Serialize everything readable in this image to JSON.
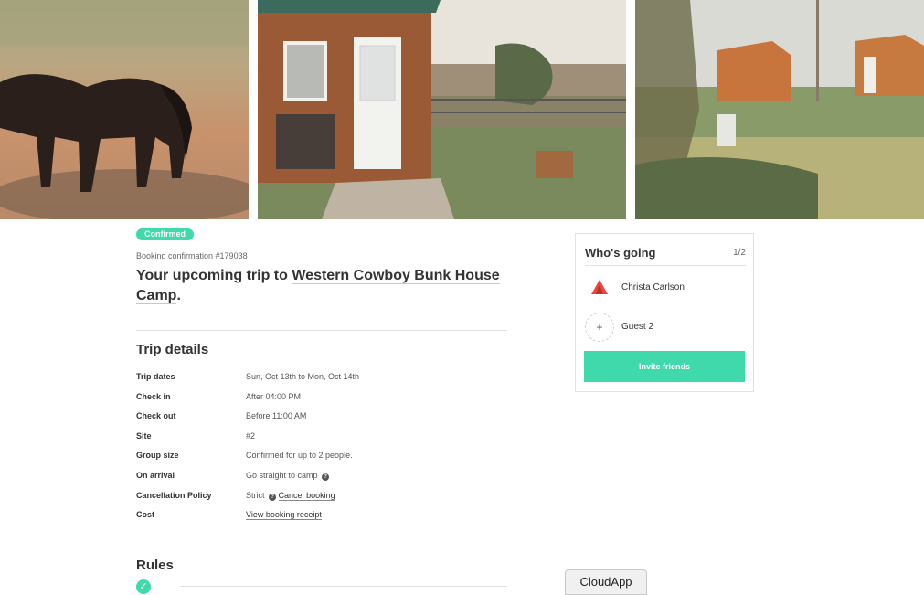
{
  "booking": {
    "status_badge": "Confirmed",
    "confirmation_label": "Booking confirmation #179038",
    "title_prefix": "Your upcoming trip to ",
    "title_link": "Western Cowboy Bunk House Camp",
    "title_suffix": "."
  },
  "trip_details": {
    "heading": "Trip details",
    "rows": [
      {
        "label": "Trip dates",
        "value": "Sun, Oct 13th to Mon, Oct 14th"
      },
      {
        "label": "Check in",
        "value": "After 04:00 PM"
      },
      {
        "label": "Check out",
        "value": "Before 11:00 AM"
      },
      {
        "label": "Site",
        "value": "#2"
      },
      {
        "label": "Group size",
        "value": "Confirmed for up to 2 people."
      },
      {
        "label": "On arrival",
        "value": "Go straight to camp",
        "help_icon": "question-circle-icon"
      },
      {
        "label": "Cancellation Policy",
        "value": "Strict",
        "help_icon": "question-circle-icon",
        "link": "Cancel booking"
      },
      {
        "label": "Cost",
        "link": "View booking receipt"
      }
    ]
  },
  "rules": {
    "heading": "Rules",
    "icon": "check-circle-icon"
  },
  "whos_going": {
    "title": "Who's going",
    "count": "1/2",
    "people": [
      {
        "name": "Christa Carlson",
        "avatar": "red-triangle-logo-avatar"
      },
      {
        "name": "Guest 2",
        "avatar": "plus-icon"
      }
    ],
    "invite_label": "Invite friends"
  },
  "overlay": {
    "cloudapp_label": "CloudApp"
  },
  "colors": {
    "accent": "#40d9ac",
    "text": "#333333",
    "divider": "#e2e2e2"
  }
}
